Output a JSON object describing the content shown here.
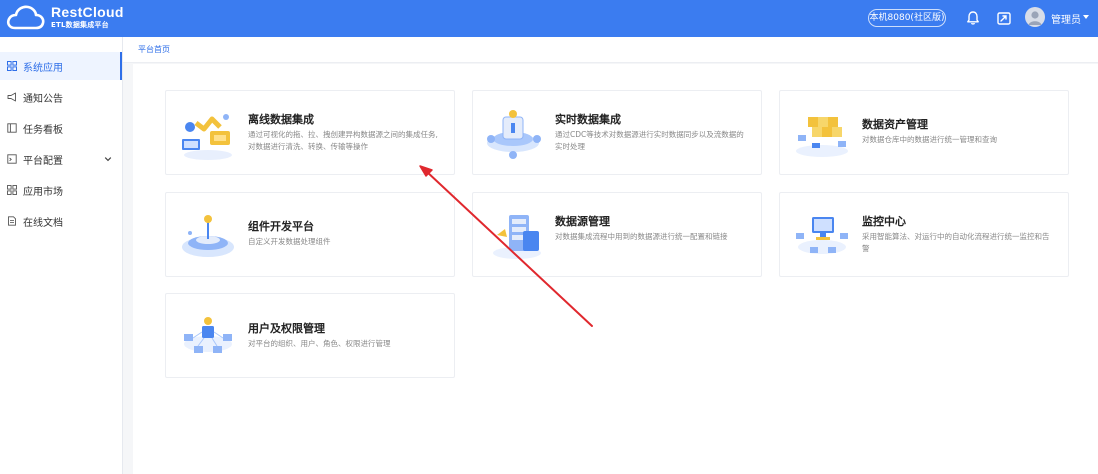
{
  "header": {
    "logo_title": "RestCloud",
    "logo_subtitle": "ETL数据集成平台",
    "env_label": "本机8080(社区版)",
    "username": "管理员",
    "accent": "#3b7cf0",
    "icons": [
      "cloud-logo-icon",
      "bell-icon",
      "share-icon",
      "avatar",
      "caret-down-icon"
    ]
  },
  "sidebar": {
    "items": [
      {
        "label": "系统应用",
        "icon": "grid-icon",
        "active": true
      },
      {
        "label": "通知公告",
        "icon": "megaphone-icon",
        "active": false
      },
      {
        "label": "任务看板",
        "icon": "board-icon",
        "active": false
      },
      {
        "label": "平台配置",
        "icon": "monitor-icon",
        "active": false,
        "expandable": true
      },
      {
        "label": "应用市场",
        "icon": "apps-icon",
        "active": false
      },
      {
        "label": "在线文档",
        "icon": "document-icon",
        "active": false
      }
    ]
  },
  "breadcrumb": "平台首页",
  "cards": [
    {
      "title": "离线数据集成",
      "desc": "通过可视化的拖、拉、拽创建异构数据源之间的集成任务,对数据进行清洗、转换、传输等操作"
    },
    {
      "title": "实时数据集成",
      "desc": "通过CDC等技术对数据源进行实时数据同步以及流数据的实时处理"
    },
    {
      "title": "数据资产管理",
      "desc": "对数据仓库中的数据进行统一管理和查询"
    },
    {
      "title": "组件开发平台",
      "desc": "自定义开发数据处理组件"
    },
    {
      "title": "数据源管理",
      "desc": "对数据集成流程中用到的数据源进行统一配置和链接"
    },
    {
      "title": "监控中心",
      "desc": "采用智能算法、对运行中的自动化流程进行统一监控和告警"
    },
    {
      "title": "用户及权限管理",
      "desc": "对平台的组织、用户、角色、权限进行管理"
    }
  ],
  "annotation": {
    "type": "arrow",
    "color": "#e0282e"
  }
}
